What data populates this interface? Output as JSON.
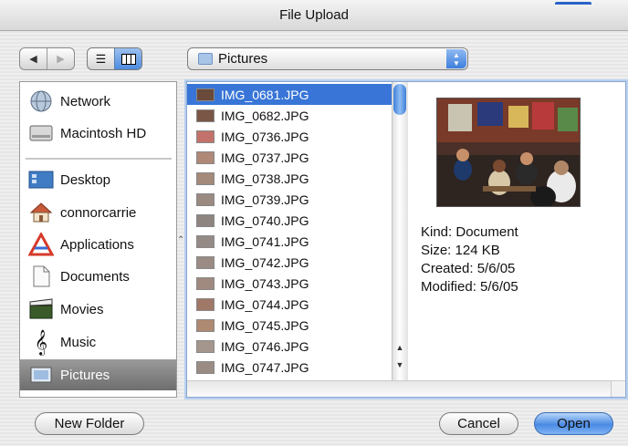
{
  "window": {
    "title": "File Upload"
  },
  "toolbar": {
    "back_icon": "left-arrow-icon",
    "forward_icon": "right-arrow-icon",
    "list_view_icon": "list-view-icon",
    "column_view_icon": "column-view-icon",
    "location": "Pictures"
  },
  "sidebar": {
    "devices": [
      {
        "label": "Network",
        "icon": "globe-icon"
      },
      {
        "label": "Macintosh HD",
        "icon": "hard-drive-icon"
      }
    ],
    "places": [
      {
        "label": "Desktop",
        "icon": "desktop-icon"
      },
      {
        "label": "connorcarrie",
        "icon": "home-icon"
      },
      {
        "label": "Applications",
        "icon": "applications-icon"
      },
      {
        "label": "Documents",
        "icon": "documents-icon"
      },
      {
        "label": "Movies",
        "icon": "clapperboard-icon"
      },
      {
        "label": "Music",
        "icon": "music-icon"
      },
      {
        "label": "Pictures",
        "icon": "pictures-icon"
      }
    ],
    "selected": "Pictures"
  },
  "files": [
    "IMG_0681.JPG",
    "IMG_0682.JPG",
    "IMG_0736.JPG",
    "IMG_0737.JPG",
    "IMG_0738.JPG",
    "IMG_0739.JPG",
    "IMG_0740.JPG",
    "IMG_0741.JPG",
    "IMG_0742.JPG",
    "IMG_0743.JPG",
    "IMG_0744.JPG",
    "IMG_0745.JPG",
    "IMG_0746.JPG",
    "IMG_0747.JPG"
  ],
  "selected_file": "IMG_0681.JPG",
  "preview": {
    "kind": "Kind: Document",
    "size": "Size: 124 KB",
    "created": "Created: 5/6/05",
    "modified": "Modified: 5/6/05"
  },
  "buttons": {
    "new_folder": "New Folder",
    "cancel": "Cancel",
    "open": "Open"
  },
  "colors": {
    "selection": "#3875d7",
    "accent": "#4a8ae4"
  }
}
